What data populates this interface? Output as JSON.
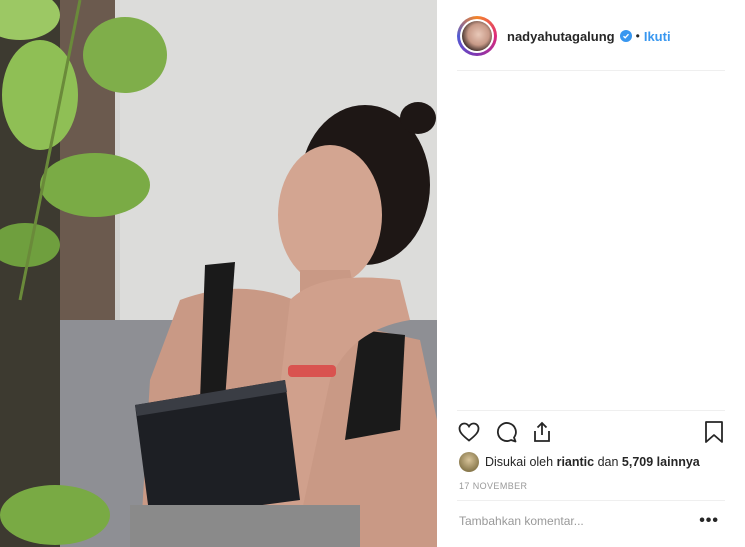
{
  "post": {
    "username": "nadyahutagalung",
    "separator": "•",
    "follow_label": "Ikuti",
    "likes": {
      "prefix": "Disukai oleh",
      "user": "riantic",
      "middle": "dan",
      "count": "5,709 lainnya"
    },
    "date": "17 NOVEMBER",
    "comment_placeholder": "Tambahkan komentar...",
    "more_label": "•••"
  },
  "icons": {
    "like": "heart-icon",
    "comment": "comment-icon",
    "share": "share-icon",
    "save": "bookmark-icon",
    "verified": "verified-badge-icon"
  },
  "colors": {
    "accent": "#3897f0",
    "text": "#262626",
    "muted": "#999999",
    "divider": "#efefef"
  }
}
